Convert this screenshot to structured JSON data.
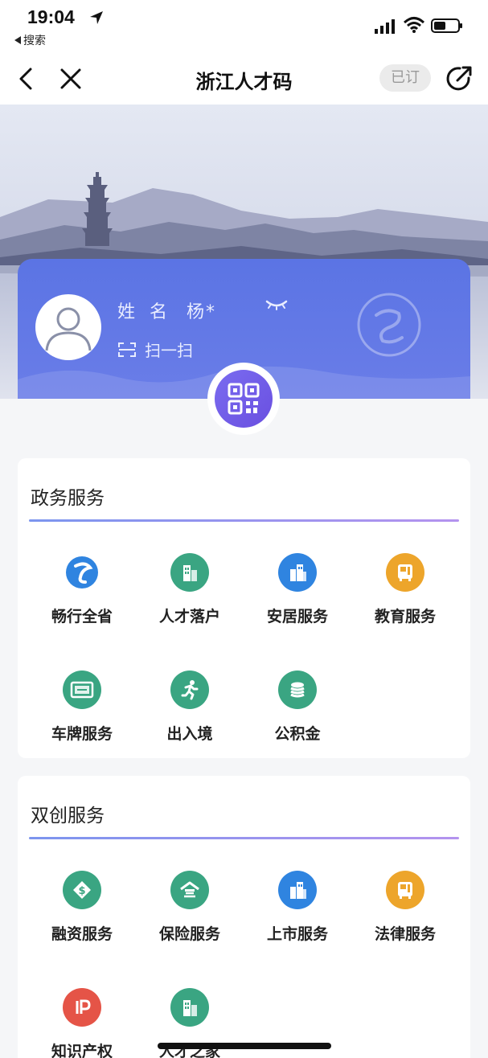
{
  "status_bar": {
    "time": "19:04",
    "back_app": "搜索"
  },
  "nav": {
    "title": "浙江人才码",
    "subscribe_label": "已订"
  },
  "profile": {
    "name_label": "姓名",
    "name_value": "杨*",
    "scan_label": "扫一扫"
  },
  "sections": [
    {
      "title": "政务服务",
      "items": [
        {
          "label": "畅行全省",
          "icon": "phoenix-logo-icon",
          "color": "#2f84e0"
        },
        {
          "label": "人才落户",
          "icon": "building-icon",
          "color": "#3aa582"
        },
        {
          "label": "安居服务",
          "icon": "buildings-icon",
          "color": "#2f84e0"
        },
        {
          "label": "教育服务",
          "icon": "school-bus-icon",
          "color": "#eda52b"
        },
        {
          "label": "车牌服务",
          "icon": "license-plate-icon",
          "color": "#3aa582"
        },
        {
          "label": "出入境",
          "icon": "running-person-icon",
          "color": "#3aa582"
        },
        {
          "label": "公积金",
          "icon": "coins-icon",
          "color": "#3aa582"
        }
      ]
    },
    {
      "title": "双创服务",
      "items": [
        {
          "label": "融资服务",
          "icon": "diamond-money-icon",
          "color": "#3aa582"
        },
        {
          "label": "保险服务",
          "icon": "shelter-icon",
          "color": "#3aa582"
        },
        {
          "label": "上市服务",
          "icon": "buildings-icon",
          "color": "#2f84e0"
        },
        {
          "label": "法律服务",
          "icon": "school-bus-icon",
          "color": "#eda52b"
        },
        {
          "label": "知识产权",
          "icon": "ip-icon",
          "color": "#e55447"
        },
        {
          "label": "人才之家",
          "icon": "building-icon",
          "color": "#3aa582"
        }
      ]
    }
  ]
}
